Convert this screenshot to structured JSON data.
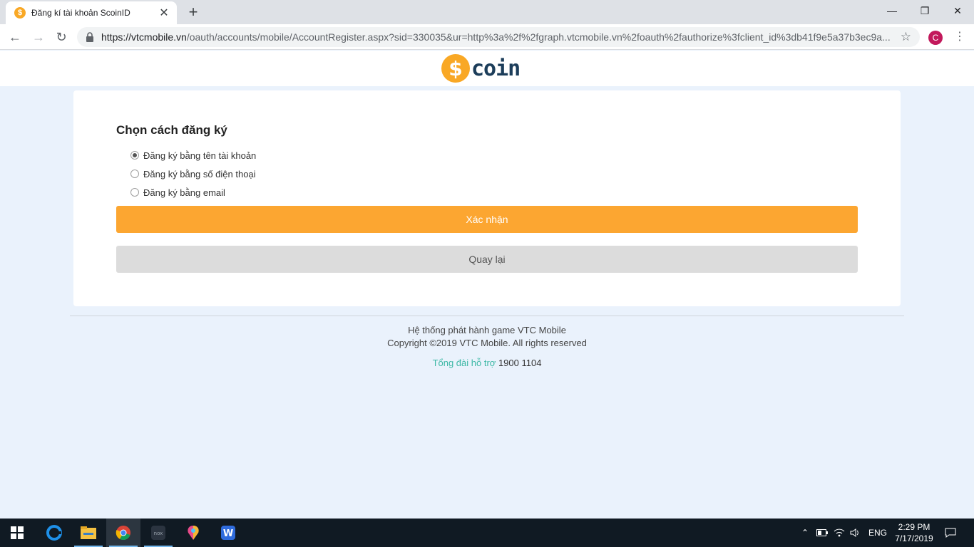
{
  "browser": {
    "tab_title": "Đăng kí tài khoản ScoinID",
    "url_host": "https://vtcmobile.vn",
    "url_path": "/oauth/accounts/mobile/AccountRegister.aspx?sid=330035&ur=http%3a%2f%2fgraph.vtcmobile.vn%2foauth%2fauthorize%3fclient_id%3db41f9e5a37b3ec9a...",
    "profile_initial": "C"
  },
  "header": {
    "logo_symbol": "$",
    "logo_text": "coin"
  },
  "form": {
    "title": "Chọn cách đăng ký",
    "options": [
      {
        "label": "Đăng ký bằng tên tài khoản",
        "checked": true
      },
      {
        "label": "Đăng ký bằng số điện thoại",
        "checked": false
      },
      {
        "label": "Đăng ký bằng email",
        "checked": false
      }
    ],
    "confirm_label": "Xác nhận",
    "back_label": "Quay lại"
  },
  "footer": {
    "line1": "Hệ thống phát hành game VTC Mobile",
    "line2": "Copyright ©2019 VTC Mobile. All rights reserved",
    "support_label": "Tổng đài hỗ trợ",
    "support_number": "1900 1104"
  },
  "taskbar": {
    "language": "ENG",
    "time": "2:29 PM",
    "date": "7/17/2019"
  },
  "colors": {
    "accent": "#fca631",
    "page_bg": "#eaf2fc",
    "support_link": "#3cb8a5"
  }
}
